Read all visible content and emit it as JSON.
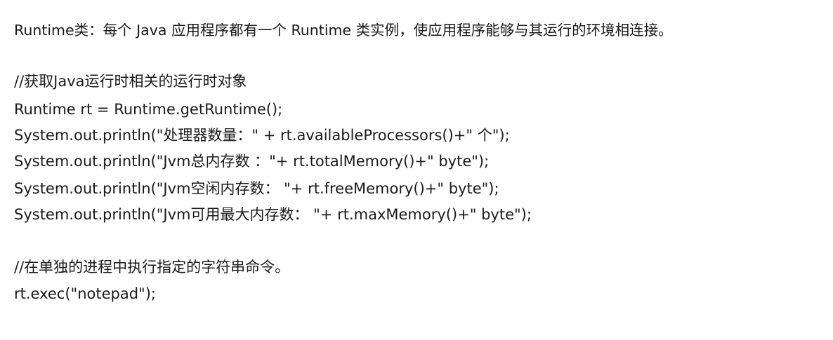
{
  "document": {
    "intro": "Runtime类：每个 Java 应用程序都有一个 Runtime 类实例，使应用程序能够与其运行的环境相连接。",
    "comment_get_runtime": "//获取Java运行时相关的运行时对象",
    "code_lines": [
      "Runtime rt = Runtime.getRuntime();",
      "System.out.println(\"处理器数量：\" + rt.availableProcessors()+\" 个\");",
      "System.out.println(\"Jvm总内存数 ：\"+ rt.totalMemory()+\" byte\");",
      "System.out.println(\"Jvm空闲内存数： \"+ rt.freeMemory()+\" byte\");",
      "System.out.println(\"Jvm可用最大内存数： \"+ rt.maxMemory()+\" byte\");"
    ],
    "comment_exec": "//在单独的进程中执行指定的字符串命令。",
    "exec_line": "rt.exec(\"notepad\");"
  }
}
